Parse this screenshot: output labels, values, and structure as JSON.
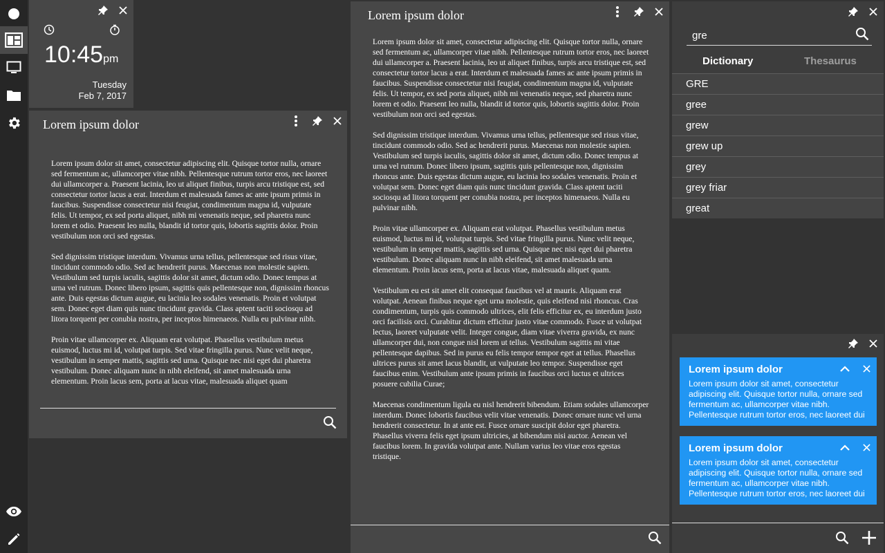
{
  "sidebar": {
    "items": [
      {
        "icon": "circle-icon"
      },
      {
        "icon": "dashboard-icon"
      },
      {
        "icon": "monitor-icon"
      },
      {
        "icon": "folder-icon"
      },
      {
        "icon": "gear-icon"
      },
      {
        "icon": "eye-icon"
      },
      {
        "icon": "pencil-icon"
      }
    ]
  },
  "clock": {
    "time": "10:45",
    "ampm": "pm",
    "day": "Tuesday",
    "date": "Feb 7, 2017"
  },
  "panel_left": {
    "title": "Lorem ipsum dolor",
    "paragraphs": [
      "Lorem ipsum dolor sit amet, consectetur adipiscing elit. Quisque tortor nulla, ornare sed fermentum ac, ullamcorper vitae nibh. Pellentesque rutrum tortor eros, nec laoreet dui ullamcorper a. Praesent lacinia, leo ut aliquet finibus, turpis arcu tristique est, sed consectetur tortor lacus a erat. Interdum et malesuada fames ac ante ipsum primis in faucibus. Suspendisse consectetur nisi feugiat, condimentum magna id, vulputate felis. Ut tempor, ex sed porta aliquet, nibh mi venenatis neque, sed pharetra nunc lorem et odio. Praesent leo nulla, blandit id tortor quis, lobortis sagittis dolor. Proin vestibulum non orci sed egestas.",
      "Sed dignissim tristique interdum. Vivamus urna tellus, pellentesque sed risus vitae, tincidunt commodo odio. Sed ac hendrerit purus. Maecenas non molestie sapien. Vestibulum sed turpis iaculis, sagittis dolor sit amet, dictum odio. Donec tempus at urna vel rutrum. Donec libero ipsum, sagittis quis pellentesque non, dignissim rhoncus ante. Duis egestas dictum augue, eu lacinia leo sodales venenatis. Proin et volutpat sem. Donec eget diam quis nunc tincidunt gravida. Class aptent taciti sociosqu ad litora torquent per conubia nostra, per inceptos himenaeos. Nulla eu pulvinar nibh.",
      "Proin vitae ullamcorper ex. Aliquam erat volutpat. Phasellus vestibulum metus euismod, luctus mi id, volutpat turpis. Sed vitae fringilla purus. Nunc velit neque, vestibulum in semper mattis, sagittis sed urna. Quisque nec nisi eget dui pharetra vestibulum. Donec aliquam nunc in nibh eleifend, sit amet malesuada urna elementum. Proin lacus sem, porta at lacus vitae, malesuada aliquet quam"
    ]
  },
  "panel_middle": {
    "title": "Lorem ipsum dolor",
    "paragraphs": [
      "Lorem ipsum dolor sit amet, consectetur adipiscing elit. Quisque tortor nulla, ornare sed fermentum ac, ullamcorper vitae nibh. Pellentesque rutrum tortor eros, nec laoreet dui ullamcorper a. Praesent lacinia, leo ut aliquet finibus, turpis arcu tristique est, sed consectetur tortor lacus a erat. Interdum et malesuada fames ac ante ipsum primis in faucibus. Suspendisse consectetur nisi feugiat, condimentum magna id, vulputate felis. Ut tempor, ex sed porta aliquet, nibh mi venenatis neque, sed pharetra nunc lorem et odio. Praesent leo nulla, blandit id tortor quis, lobortis sagittis dolor. Proin vestibulum non orci sed egestas.",
      "Sed dignissim tristique interdum. Vivamus urna tellus, pellentesque sed risus vitae, tincidunt commodo odio. Sed ac hendrerit purus. Maecenas non molestie sapien. Vestibulum sed turpis iaculis, sagittis dolor sit amet, dictum odio. Donec tempus at urna vel rutrum. Donec libero ipsum, sagittis quis pellentesque non, dignissim rhoncus ante. Duis egestas dictum augue, eu lacinia leo sodales venenatis. Proin et volutpat sem. Donec eget diam quis nunc tincidunt gravida. Class aptent taciti sociosqu ad litora torquent per conubia nostra, per inceptos himenaeos. Nulla eu pulvinar nibh.",
      "Proin vitae ullamcorper ex. Aliquam erat volutpat. Phasellus vestibulum metus euismod, luctus mi id, volutpat turpis. Sed vitae fringilla purus. Nunc velit neque, vestibulum in semper mattis, sagittis sed urna. Quisque nec nisi eget dui pharetra vestibulum. Donec aliquam nunc in nibh eleifend, sit amet malesuada urna elementum. Proin lacus sem, porta at lacus vitae, malesuada aliquet quam.",
      "Vestibulum eu est sit amet elit consequat faucibus vel at mauris. Aliquam erat volutpat. Aenean finibus neque eget urna molestie, quis eleifend nisi rhoncus. Cras condimentum, turpis quis commodo ultrices, elit felis efficitur ex, eu interdum justo orci facilisis orci. Curabitur dictum efficitur justo vitae commodo. Fusce ut volutpat lectus, laoreet vulputate velit. Integer congue, diam vitae viverra gravida, ex nunc ullamcorper dui, non congue nisl lorem ut tellus. Vestibulum sagittis mi vitae pellentesque dapibus. Sed in purus eu felis tempor tempor eget at tellus. Phasellus ultrices purus sit amet lacus blandit, ut vulputate leo tempor. Suspendisse eget faucibus enim. Vestibulum ante ipsum primis in faucibus orci luctus et ultrices posuere cubilia Curae;",
      "Maecenas condimentum ligula eu nisl hendrerit bibendum. Etiam sodales ullamcorper interdum. Donec lobortis faucibus velit vitae venenatis. Donec ornare nunc vel urna hendrerit consectetur. In at ante est. Fusce ornare suscipit dolor eget pharetra. Phasellus viverra felis eget ipsum ultricies, at bibendum nisi auctor. Aenean vel faucibus lorem. In gravida volutpat ante. Nullam varius leo vitae eros egestas tristique."
    ]
  },
  "dictionary": {
    "query": "gre",
    "tabs": [
      "Dictionary",
      "Thesaurus"
    ],
    "active_tab": "Dictionary",
    "results": [
      "GRE",
      "gree",
      "grew",
      "grew up",
      "grey",
      "grey friar",
      "great"
    ]
  },
  "notes": [
    {
      "title": "Lorem ipsum dolor",
      "body": "Lorem ipsum dolor sit amet, consectetur adipiscing elit. Quisque tortor nulla, ornare sed fermentum ac, ullamcorper vitae nibh. Pellentesque rutrum tortor eros, nec laoreet dui"
    },
    {
      "title": "Lorem ipsum dolor",
      "body": "Lorem ipsum dolor sit amet, consectetur adipiscing elit. Quisque tortor nulla, ornare sed fermentum ac, ullamcorper vitae nibh. Pellentesque rutrum tortor eros, nec laoreet dui"
    }
  ],
  "colors": {
    "background": "#333333",
    "panel": "#474747",
    "sidebar": "#262626",
    "note_accent": "#2196f3",
    "tab_inactive": "#9e9e9e"
  }
}
